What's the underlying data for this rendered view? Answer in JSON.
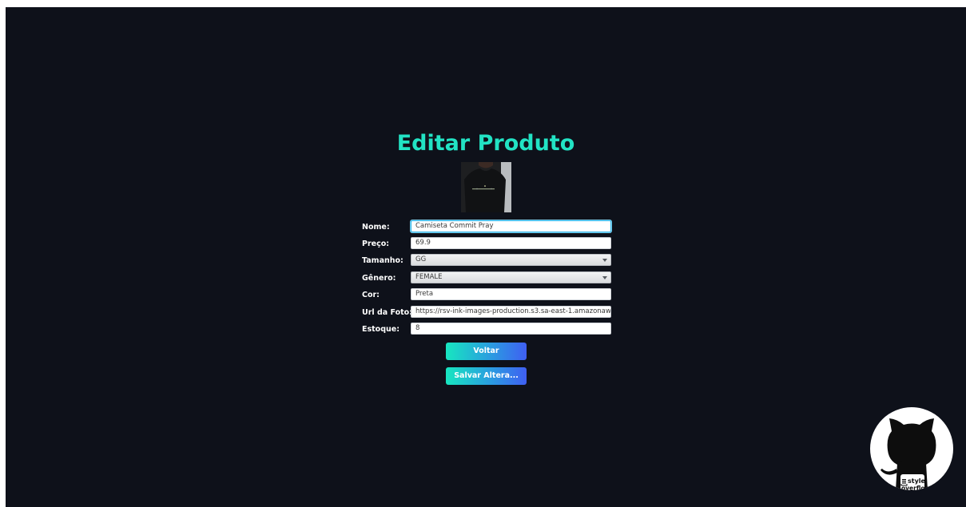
{
  "page": {
    "title": "Editar Produto"
  },
  "product_image": {
    "alt": "Camiseta Commit Pray"
  },
  "form": {
    "fields": [
      {
        "label": "Nome:",
        "value": "Camiseta Commit Pray"
      },
      {
        "label": "Preço:",
        "value": "69.9"
      },
      {
        "label": "Tamanho:",
        "value": "GG"
      },
      {
        "label": "Gênero:",
        "value": "FEMALE"
      },
      {
        "label": "Cor:",
        "value": "Preta"
      },
      {
        "label": "Url da Foto:",
        "value": "https://rsv-ink-images-production.s3.sa-east-1.amazonaws"
      },
      {
        "label": "Estoque:",
        "value": "8"
      }
    ]
  },
  "buttons": {
    "back": "Voltar",
    "save": "Salvar Altera..."
  },
  "logo": {
    "text_top": "style",
    "text_bottom": "overflow"
  },
  "colors": {
    "background": "#0e111a",
    "title": "#22e3c4",
    "button_gradient_start": "#17e6c0",
    "button_gradient_end": "#3f5ff2"
  },
  "icons": {
    "select_arrow": "chevron-down-icon",
    "logo": "github-octocat-icon"
  }
}
